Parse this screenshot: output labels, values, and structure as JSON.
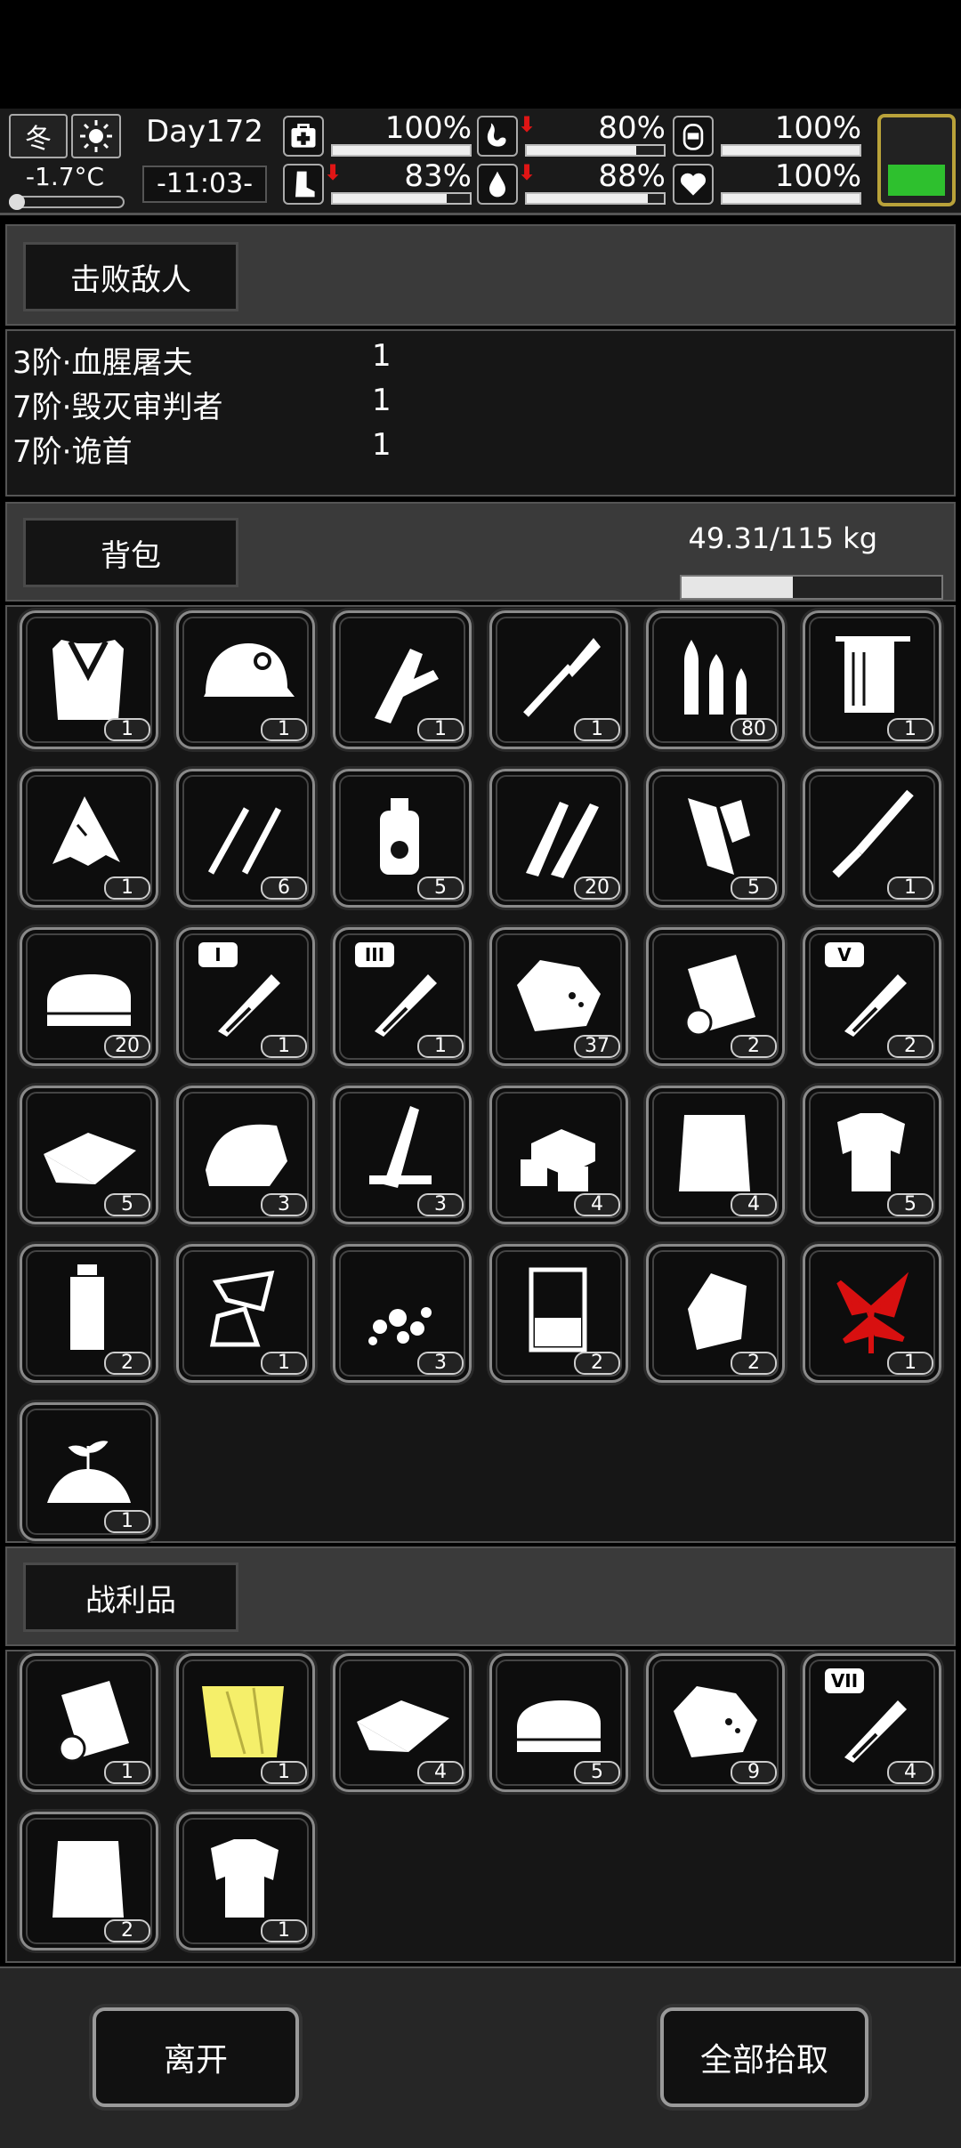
{
  "status": {
    "season": "冬",
    "temperature": "-1.7°C",
    "day": "Day172",
    "time": "-11:03-",
    "stats": [
      {
        "icon": "medkit-icon",
        "value": "100%",
        "level": 1.0,
        "down": false
      },
      {
        "icon": "stomach-icon",
        "value": "80%",
        "level": 0.8,
        "down": true
      },
      {
        "icon": "mask-icon",
        "value": "100%",
        "level": 1.0,
        "down": false
      },
      {
        "icon": "boot-icon",
        "value": "83%",
        "level": 0.83,
        "down": true
      },
      {
        "icon": "water-drop-icon",
        "value": "88%",
        "level": 0.88,
        "down": true
      },
      {
        "icon": "heart-icon",
        "value": "100%",
        "level": 1.0,
        "down": false
      }
    ],
    "battery_level": 0.4,
    "battery_color": "#2ec02e"
  },
  "defeated": {
    "tab": "击败敌人",
    "enemies": [
      {
        "name": "3阶·血腥屠夫",
        "count": "1"
      },
      {
        "name": "7阶·毁灭审判者",
        "count": "1"
      },
      {
        "name": "7阶·诡首",
        "count": "1"
      }
    ]
  },
  "backpack": {
    "tab": "背包",
    "weight": "49.31/115 kg",
    "weight_level": 0.4288,
    "items": [
      {
        "icon": "fur-coat-icon",
        "count": "1"
      },
      {
        "icon": "helmet-icon",
        "count": "1"
      },
      {
        "icon": "caliper-knife-icon",
        "count": "1"
      },
      {
        "icon": "shovel-icon",
        "count": "1"
      },
      {
        "icon": "bullets-icon",
        "count": "80"
      },
      {
        "icon": "towel-icon",
        "count": "1"
      },
      {
        "icon": "torn-cloth-icon",
        "count": "1"
      },
      {
        "icon": "picks-icon",
        "count": "6"
      },
      {
        "icon": "spray-can-icon",
        "count": "5"
      },
      {
        "icon": "pencils-icon",
        "count": "20"
      },
      {
        "icon": "paper-scroll-icon",
        "count": "5"
      },
      {
        "icon": "screwdriver-icon",
        "count": "1"
      },
      {
        "icon": "folded-cloth-icon",
        "count": "20"
      },
      {
        "icon": "test-tube-icon",
        "count": "1",
        "tier": "I"
      },
      {
        "icon": "test-tube-icon",
        "count": "1",
        "tier": "III"
      },
      {
        "icon": "ore-rock-icon",
        "count": "37"
      },
      {
        "icon": "cloth-roll-icon",
        "count": "2"
      },
      {
        "icon": "test-tube-icon",
        "count": "2",
        "tier": "V"
      },
      {
        "icon": "fabric-icon",
        "count": "5"
      },
      {
        "icon": "towel-fold-icon",
        "count": "3"
      },
      {
        "icon": "wood-planks-icon",
        "count": "3"
      },
      {
        "icon": "bricks-icon",
        "count": "4"
      },
      {
        "icon": "sack-icon",
        "count": "4"
      },
      {
        "icon": "ragged-shirt-icon",
        "count": "5"
      },
      {
        "icon": "water-bottle-icon",
        "count": "2"
      },
      {
        "icon": "glass-shards-icon",
        "count": "1"
      },
      {
        "icon": "gravel-icon",
        "count": "3"
      },
      {
        "icon": "beaker-icon",
        "count": "2"
      },
      {
        "icon": "crumpled-paper-icon",
        "count": "2"
      },
      {
        "icon": "red-herb-icon",
        "count": "1"
      },
      {
        "icon": "soil-sprout-icon",
        "count": "1"
      }
    ]
  },
  "loot": {
    "tab": "战利品",
    "items": [
      {
        "icon": "cloth-roll-icon",
        "count": "1"
      },
      {
        "icon": "yellow-cloth-icon",
        "count": "1"
      },
      {
        "icon": "fabric-icon",
        "count": "4"
      },
      {
        "icon": "folded-cloth-icon",
        "count": "5"
      },
      {
        "icon": "ore-rock-icon",
        "count": "9"
      },
      {
        "icon": "test-tube-icon",
        "count": "4",
        "tier": "VII"
      },
      {
        "icon": "sack-icon",
        "count": "2"
      },
      {
        "icon": "ragged-shirt-icon",
        "count": "1"
      }
    ]
  },
  "buttons": {
    "leave": "离开",
    "take_all": "全部拾取"
  }
}
